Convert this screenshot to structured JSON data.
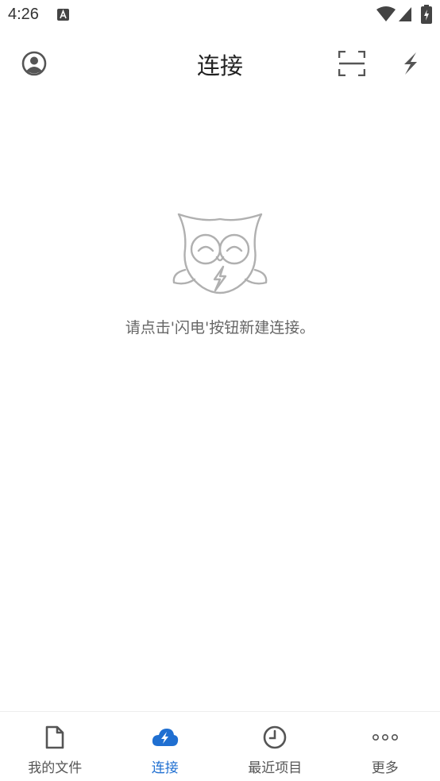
{
  "status_bar": {
    "time": "4:26"
  },
  "app_bar": {
    "title": "连接"
  },
  "empty_state": {
    "message": "请点击'闪电'按钮新建连接。"
  },
  "bottom_nav": {
    "items": [
      {
        "label": "我的文件",
        "icon": "document-icon",
        "active": false
      },
      {
        "label": "连接",
        "icon": "cloud-flash-icon",
        "active": true
      },
      {
        "label": "最近项目",
        "icon": "clock-icon",
        "active": false
      },
      {
        "label": "更多",
        "icon": "more-dots-icon",
        "active": false
      }
    ]
  },
  "colors": {
    "accent": "#1f6fd1",
    "icon": "#555555",
    "empty_text": "#666666",
    "owl_stroke": "#b0b0b0"
  }
}
